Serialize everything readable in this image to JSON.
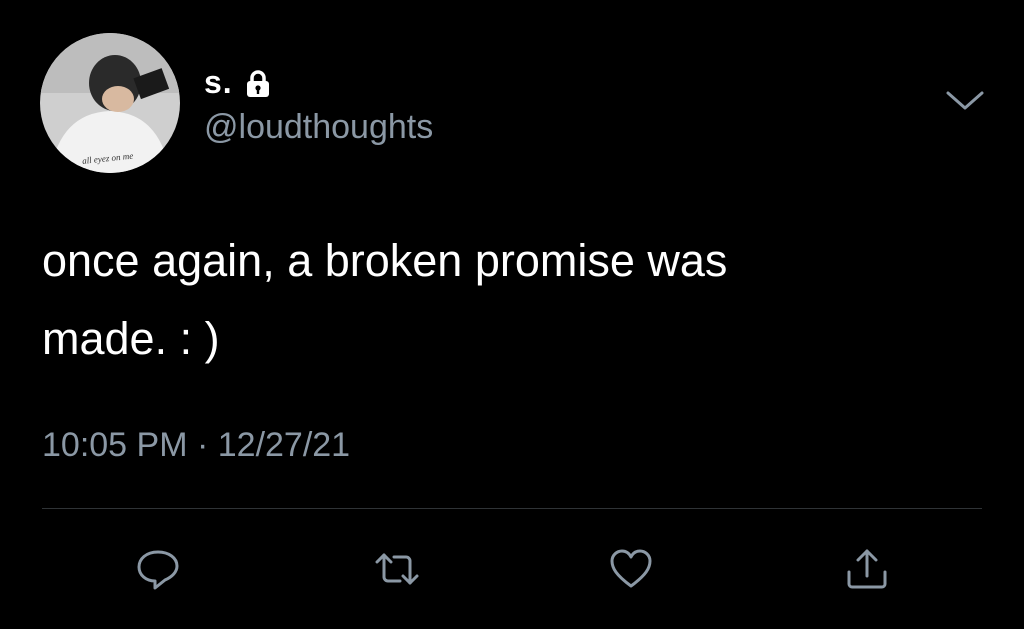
{
  "tweet": {
    "display_name": "s.",
    "handle": "@loudthoughts",
    "text_line1": "once again, a broken promise was",
    "text_line2": "made. : )",
    "timestamp": "10:05 PM · 12/27/21",
    "avatar_shirt_text": "all eyez on me"
  },
  "icons": {
    "lock": "lock-icon",
    "caret": "chevron-down-icon",
    "reply": "reply-icon",
    "retweet": "retweet-icon",
    "like": "heart-icon",
    "share": "share-icon"
  },
  "colors": {
    "background": "#000000",
    "text_primary": "#ffffff",
    "text_secondary": "#8b98a5",
    "divider": "#2f3336"
  }
}
